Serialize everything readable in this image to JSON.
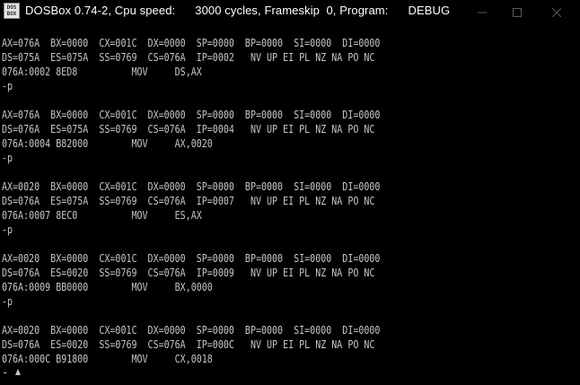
{
  "window": {
    "title": "DOSBox 0.74-2, Cpu speed:",
    "speed": "3000 cycles, Frameskip  0, Program:",
    "program": "DEBUG",
    "icon_text": "DOS BOX",
    "controls": [
      "minimize-icon",
      "maximize-icon",
      "close-icon"
    ]
  },
  "console": {
    "lines": [
      "AX=076A  BX=0000  CX=001C  DX=0000  SP=0000  BP=0000  SI=0000  DI=0000",
      "DS=075A  ES=075A  SS=0769  CS=076A  IP=0002   NV UP EI PL NZ NA PO NC",
      "076A:0002 8ED8          MOV     DS,AX",
      "-p",
      "",
      "AX=076A  BX=0000  CX=001C  DX=0000  SP=0000  BP=0000  SI=0000  DI=0000",
      "DS=076A  ES=075A  SS=0769  CS=076A  IP=0004   NV UP EI PL NZ NA PO NC",
      "076A:0004 B82000        MOV     AX,0020",
      "-p",
      "",
      "AX=0020  BX=0000  CX=001C  DX=0000  SP=0000  BP=0000  SI=0000  DI=0000",
      "DS=076A  ES=075A  SS=0769  CS=076A  IP=0007   NV UP EI PL NZ NA PO NC",
      "076A:0007 8EC0          MOV     ES,AX",
      "-p",
      "",
      "AX=0020  BX=0000  CX=001C  DX=0000  SP=0000  BP=0000  SI=0000  DI=0000",
      "DS=076A  ES=0020  SS=0769  CS=076A  IP=0009   NV UP EI PL NZ NA PO NC",
      "076A:0009 BB0000        MOV     BX,0000",
      "-p",
      "",
      "AX=0020  BX=0000  CX=001C  DX=0000  SP=0000  BP=0000  SI=0000  DI=0000",
      "DS=076A  ES=0020  SS=0769  CS=076A  IP=000C   NV UP EI PL NZ NA PO NC",
      "076A:000C B91800        MOV     CX,0018"
    ],
    "prompt": "-",
    "text_color": "#c6c6c6",
    "background": "#000000"
  }
}
